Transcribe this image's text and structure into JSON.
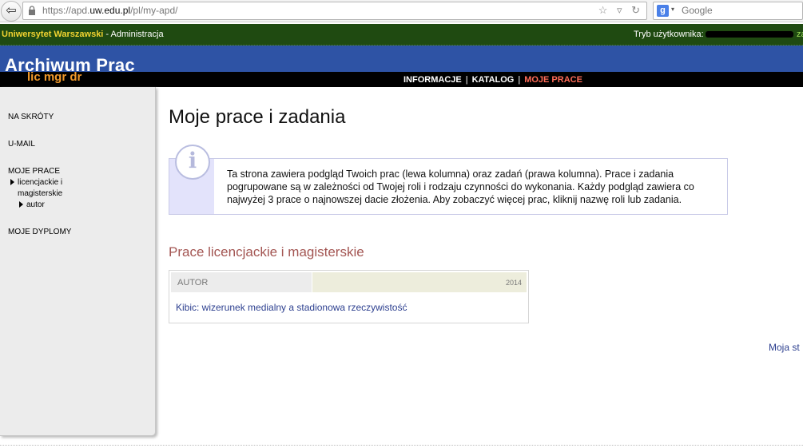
{
  "browser": {
    "url_prefix": "https://apd.",
    "url_domain": "uw.edu.pl",
    "url_path": "/pl/my-apd/",
    "search_placeholder": "Google",
    "back_glyph": "⇦",
    "url_icons": "☆ ▿ ↻",
    "search_engine_glyph": "g",
    "search_dropdown_glyph": "▾"
  },
  "topbar": {
    "university": "Uniwersytet Warszawski",
    "separator": " - ",
    "admin": "Administracja",
    "user_mode_label": "Tryb użytkownika:",
    "edge_text": "za"
  },
  "header": {
    "title": "Archiwum Prac",
    "subtitle": "lic mgr dr"
  },
  "nav": {
    "items": [
      {
        "label": "INFORMACJE",
        "active": false
      },
      {
        "label": "KATALOG",
        "active": false
      },
      {
        "label": "MOJE PRACE",
        "active": true
      }
    ],
    "separator": "|"
  },
  "sidebar": {
    "shortcuts": "NA SKRÓTY",
    "umail": "U-MAIL",
    "my_works": "MOJE PRACE",
    "sub_line1": "licencjackie i",
    "sub_line2": "magisterskie",
    "sub_sub": "autor",
    "diplomas": "MOJE DYPLOMY"
  },
  "main": {
    "title": "Moje prace i zadania",
    "info_icon": "i",
    "info_text": "Ta strona zawiera podgląd Twoich prac (lewa kolumna) oraz zadań (prawa kolumna). Prace i zadania pogrupowane są w zależności od Twojej roli i rodzaju czynności do wykonania. Każdy podgląd zawiera co najwyżej 3 prace o najnowszej dacie złożenia. Aby zobaczyć więcej prac, kliknij nazwę roli lub zadania.",
    "section_title": "Prace licencjackie i magisterskie",
    "table": {
      "role_label": "AUTOR",
      "year": "2014",
      "rows": [
        {
          "title": "Kibic: wizerunek medialny a stadionowa rzeczywistość"
        }
      ]
    },
    "more_link": "Moja st"
  }
}
